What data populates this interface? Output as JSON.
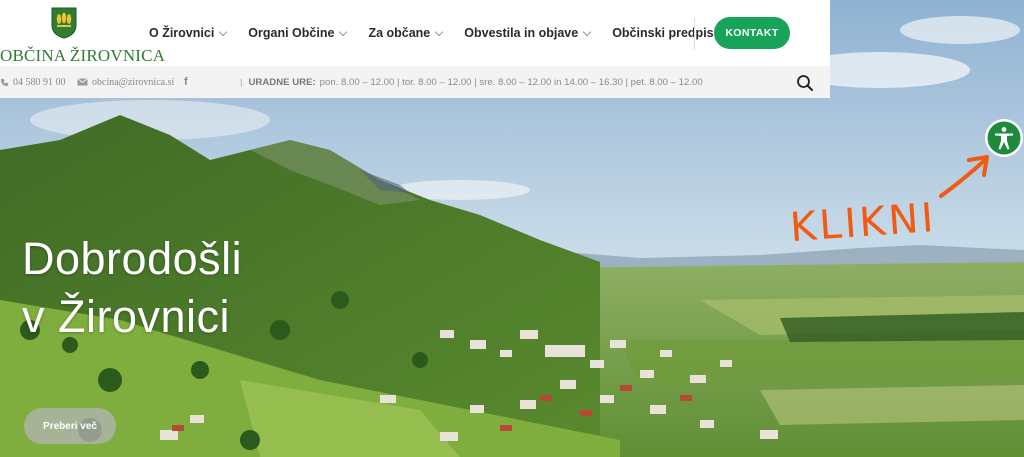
{
  "logo": {
    "text": "OBČINA ŽIROVNICA"
  },
  "nav": {
    "items": [
      {
        "label": "O Žirovnici"
      },
      {
        "label": "Organi Občine"
      },
      {
        "label": "Za občane"
      },
      {
        "label": "Obvestila in objave"
      },
      {
        "label": "Občinski predpisi"
      }
    ],
    "contact_label": "KONTAKT"
  },
  "info": {
    "phone": "04 580 91 00",
    "email": "obcina@zirovnica.si",
    "facebook_icon": "f",
    "separator": "|",
    "hours_label": "URADNE URE:",
    "hours_text": "pon. 8.00 – 12.00 | tor. 8.00 – 12.00 | sre. 8.00 – 12.00 in 14.00 – 16.30 | pet. 8.00 – 12.00"
  },
  "hero": {
    "title_line1": "Dobrodošli",
    "title_line2": "v Žirovnici",
    "button_label": "Preberi več"
  },
  "annotation": {
    "text": "KLIKNI"
  },
  "colors": {
    "brand_green": "#18a35a",
    "logo_green": "#2e7d32",
    "annotation_orange": "#f05a12"
  },
  "icons": {
    "search": "search-icon",
    "phone": "phone-icon",
    "mail": "mail-icon",
    "facebook": "facebook-icon",
    "accessibility": "accessibility-icon"
  }
}
